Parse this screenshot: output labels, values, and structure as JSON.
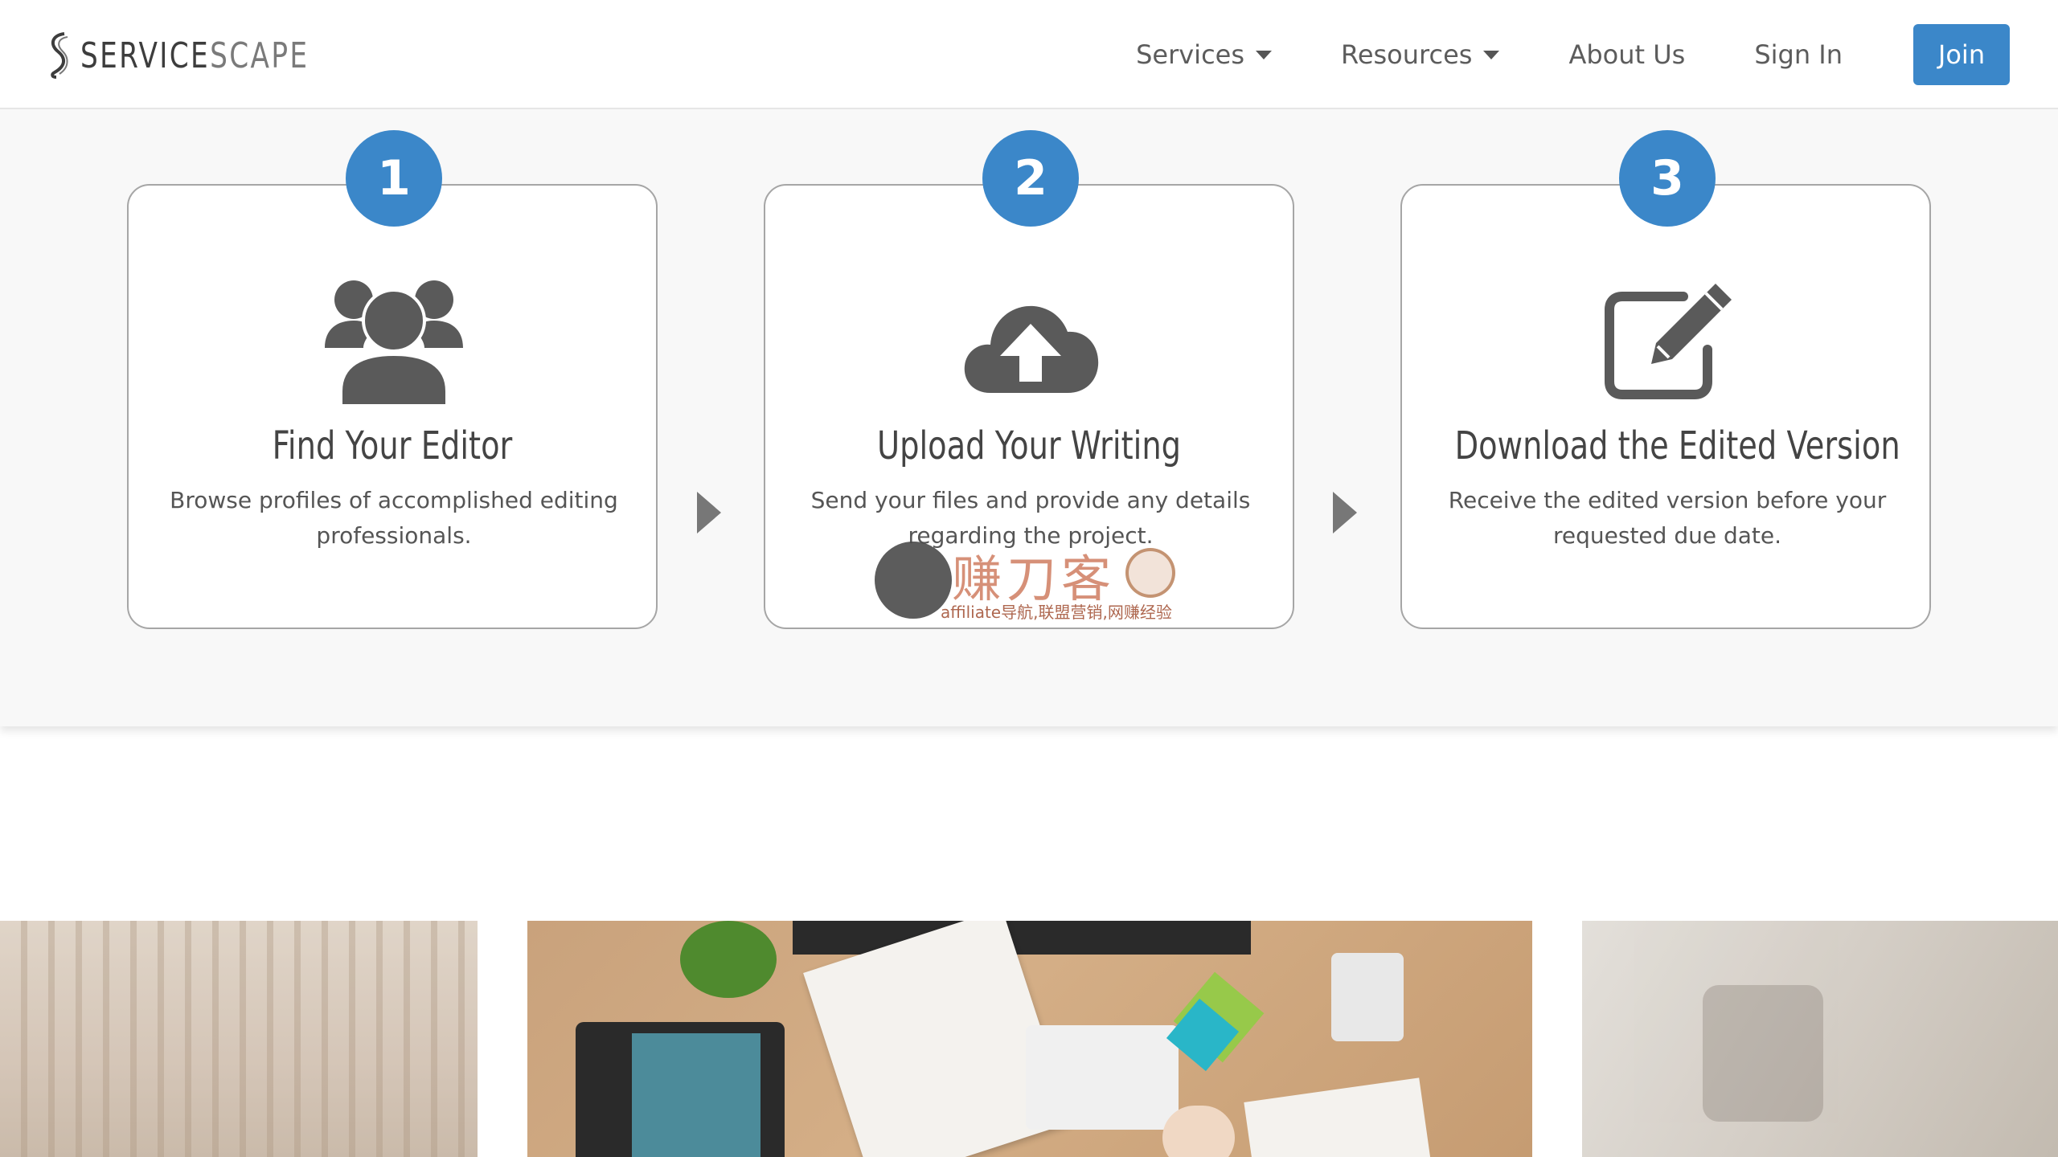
{
  "header": {
    "logo_text_bold": "SERVICE",
    "logo_text_light": "SCAPE",
    "nav": {
      "services": "Services",
      "resources": "Resources",
      "about": "About Us",
      "signin": "Sign In",
      "join": "Join"
    }
  },
  "steps": [
    {
      "number": "1",
      "icon": "users-icon",
      "title": "Find Your Editor",
      "description": "Browse profiles of accomplished editing professionals."
    },
    {
      "number": "2",
      "icon": "cloud-upload-icon",
      "title": "Upload Your Writing",
      "description": "Send your files and provide any details regarding the project."
    },
    {
      "number": "3",
      "icon": "edit-icon",
      "title": "Download the Edited Version",
      "description": "Receive the edited version before your requested due date."
    }
  ],
  "watermark": {
    "title": "赚刀客",
    "subtitle": "affiliate导航,联盟营销,网赚经验"
  },
  "colors": {
    "accent": "#3b87c9",
    "icon": "#5a5a5a",
    "section_bg": "#f8f8f8"
  }
}
